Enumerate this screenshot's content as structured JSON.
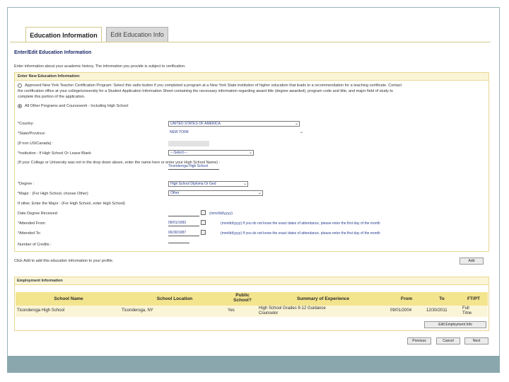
{
  "tabs": {
    "active": "Education Information",
    "inactive": "Edit Education Info"
  },
  "page_heading": "Enter/Edit Education Information",
  "intro_text": "Enter information about your academic history. The information you provide is subject to verification.",
  "new_education": {
    "title": "Enter New Education Information:",
    "option_approved": "Approved New York Teacher Certification Program: Select this radio button if you completed a program at a New York State institution of higher education that leads to a recommendation for a teaching certificate. Contact",
    "option_approved_line2": "the certification office at your college/university for a Student Application Information Sheet containing the necessary information regarding award title (degree awarded), program code and title, and major field of study to",
    "option_approved_line3": "complete this portion of the application.",
    "option_other": "All Other Programs and Coursework - Including High School",
    "country_label": "*Country:",
    "country_value": "UNITED STATES OF AMERICA",
    "state_label": "*State/Province:",
    "state_value": "NEW YORK",
    "non_us_label": "(If non US/Canada) :",
    "institution_label": "*Institution : If High School Or Leave Blank",
    "institution_value": "---Select---",
    "college_not_listed_label": "(If your College or University was not in the drop down above, enter the name here or enter your High School Name) :",
    "college_not_listed_line2": "the name here or enter your High School Name) :",
    "high_school_value": "Ticonderoga High School",
    "degree_label": "*Degree :",
    "degree_value": "High School Diploma Or Ged",
    "major_label": "*Major : (For High School, choose Other)",
    "major_value": "Other",
    "other_major_label": "If other, Enter the Major : (For High School, enter High School)",
    "date_degree_label": "Date Degree Received:",
    "date_hint": "(mm/dd/yyyy)",
    "attended_from_label": "*Attended From:",
    "attended_from_value": "09/01/1983",
    "attended_from_hint": "(mm/dd/yyyy) If you do not know the exact dates of attendance, please enter the first day of the month",
    "attended_to_label": "*Attended To:",
    "attended_to_value": "06/30/1987",
    "attended_to_hint": "(mm/dd/yyyy) If you do not know the exact dates of attendance, please enter the first day of the month",
    "credits_label": "Number of Credits :"
  },
  "add_text": "Click Add to add this education information to your profile.",
  "add_button": "Add",
  "employment": {
    "title": "Employment Information",
    "columns": [
      "School Name",
      "School Location",
      "Public School?",
      "Summary of Experience",
      "From",
      "To",
      "FT/PT"
    ],
    "rows": [
      {
        "school": "Ticonderoga High School",
        "location": "Ticonderoga, NY",
        "public": "Yes",
        "summary": "High School Grades 9-12 Guidance Counselor",
        "from": "09/01/2004",
        "to": "12/30/2011",
        "ftpt": "Full Time"
      }
    ],
    "edit_button": "Edit Employment Info"
  },
  "nav": {
    "previous": "Previous",
    "cancel": "Cancel",
    "next": "Next"
  },
  "colors": {
    "accent_border": "#e8d890",
    "header_fill": "#f3e48e",
    "bottom_bar": "#8aa7ad",
    "link_blue": "#2a3f8f"
  }
}
